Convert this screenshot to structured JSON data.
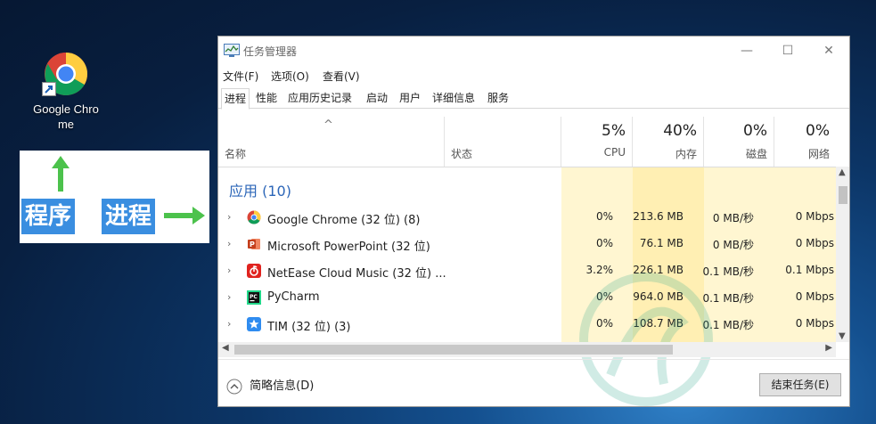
{
  "desktop": {
    "icon_label_line1": "Google Chro",
    "icon_label_line2": "me",
    "icon": "chrome-shortcut-icon"
  },
  "annotation": {
    "program_label": "程序",
    "process_label": "进程",
    "arrow_color": "#4cc24c",
    "tag_color": "#3a8ee0"
  },
  "window": {
    "title": "任务管理器",
    "minimize": "—",
    "maximize": "☐",
    "close": "✕",
    "menu": [
      "文件(F)",
      "选项(O)",
      "查看(V)"
    ],
    "tabs": [
      "进程",
      "性能",
      "应用历史记录",
      "启动",
      "用户",
      "详细信息",
      "服务"
    ],
    "active_tab": "进程"
  },
  "columns": {
    "sort_indicator": "^",
    "name": "名称",
    "status": "状态",
    "cpu": {
      "pct": "5%",
      "label": "CPU"
    },
    "memory": {
      "pct": "40%",
      "label": "内存"
    },
    "disk": {
      "pct": "0%",
      "label": "磁盘"
    },
    "network": {
      "pct": "0%",
      "label": "网络"
    }
  },
  "section_title": "应用 (10)",
  "rows": [
    {
      "name": "Google Chrome (32 位) (8)",
      "cpu": "0%",
      "memory": "213.6 MB",
      "disk": "0 MB/秒",
      "network": "0 Mbps",
      "icon": "chrome-icon"
    },
    {
      "name": "Microsoft PowerPoint (32 位)",
      "cpu": "0%",
      "memory": "76.1 MB",
      "disk": "0 MB/秒",
      "network": "0 Mbps",
      "icon": "powerpoint-icon"
    },
    {
      "name": "NetEase Cloud Music (32 位) ...",
      "cpu": "3.2%",
      "memory": "226.1 MB",
      "disk": "0.1 MB/秒",
      "network": "0.1 Mbps",
      "icon": "netease-music-icon"
    },
    {
      "name": "PyCharm",
      "cpu": "0%",
      "memory": "964.0 MB",
      "disk": "0.1 MB/秒",
      "network": "0 Mbps",
      "icon": "pycharm-icon"
    },
    {
      "name": "TIM (32 位) (3)",
      "cpu": "0%",
      "memory": "108.7 MB",
      "disk": "0.1 MB/秒",
      "network": "0 Mbps",
      "icon": "tim-icon"
    }
  ],
  "footer": {
    "less_details": "简略信息(D)",
    "end_task": "结束任务(E)"
  },
  "colors": {
    "section_blue": "#2c66b8",
    "cpu_col": "#fff4c4",
    "mem_col": "#ffe9a0",
    "disk_col": "#fff4c4",
    "net_col": "#fff4c4"
  }
}
